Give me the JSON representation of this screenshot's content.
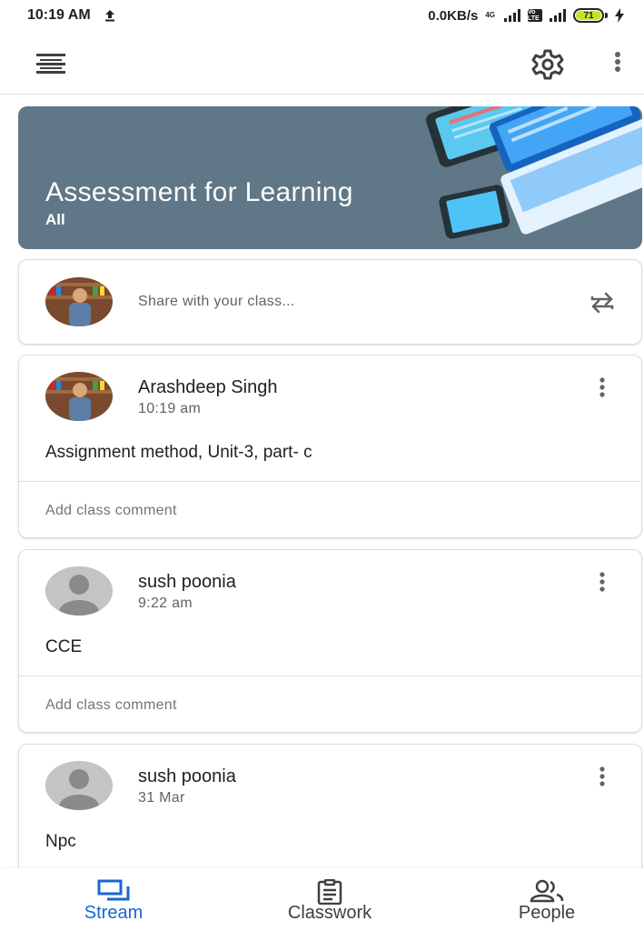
{
  "status_bar": {
    "time": "10:19 AM",
    "upload_icon": "upload-arrow-icon",
    "data_speed": "0.0KB/s",
    "network_type": "4G",
    "volte": "Vo LTE",
    "battery": "71"
  },
  "app_bar": {
    "menu_icon": "menu-icon",
    "settings_icon": "gear-icon",
    "more_icon": "more-vert-icon"
  },
  "banner": {
    "title": "Assessment for Learning",
    "subtitle": "All",
    "color": "#5f7786"
  },
  "share": {
    "placeholder": "Share with your class..."
  },
  "posts": [
    {
      "author": "Arashdeep Singh",
      "time": "10:19 am",
      "body": "Assignment method, Unit-3, part- c",
      "comment_label": "Add class comment"
    },
    {
      "author": "sush poonia",
      "time": "9:22 am",
      "body": "CCE",
      "comment_label": "Add class comment"
    },
    {
      "author": "sush poonia",
      "time": "31 Mar",
      "body": "Npc"
    }
  ],
  "bottom_nav": {
    "stream": "Stream",
    "classwork": "Classwork",
    "people": "People",
    "active_color": "#1967d2"
  }
}
